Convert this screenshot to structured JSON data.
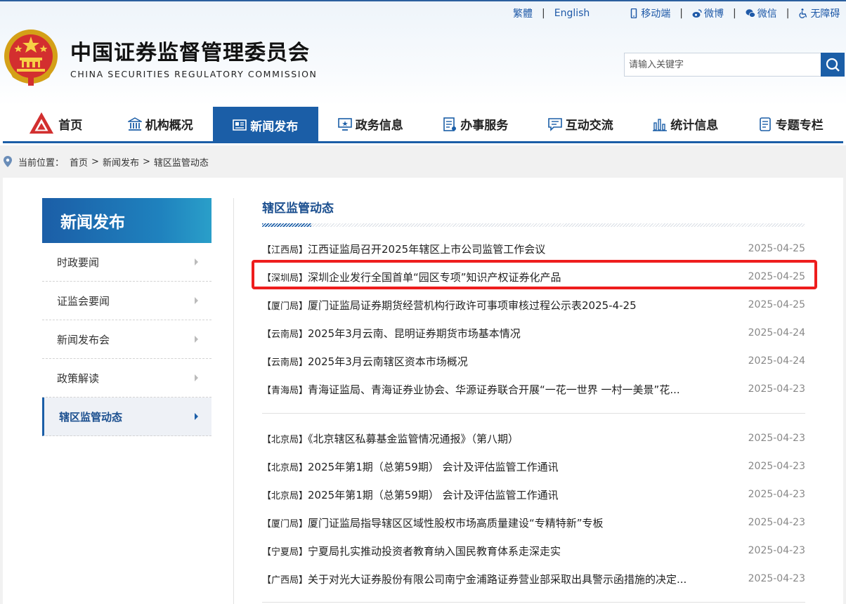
{
  "header": {
    "site_name_cn": "中国证券监督管理委员会",
    "site_name_en": "CHINA SECURITIES REGULATORY COMMISSION",
    "top_links": {
      "traditional": "繁體",
      "english": "English",
      "mobile": "移动端",
      "weibo": "微博",
      "wechat": "微信",
      "accessible": "无障碍"
    },
    "search_placeholder": "请输入关键字"
  },
  "nav": {
    "items": [
      {
        "label": "首页",
        "icon": "home-logo-icon"
      },
      {
        "label": "机构概况",
        "icon": "institution-icon"
      },
      {
        "label": "新闻发布",
        "icon": "newspaper-icon"
      },
      {
        "label": "政务信息",
        "icon": "monitor-icon"
      },
      {
        "label": "办事服务",
        "icon": "document-list-icon"
      },
      {
        "label": "互动交流",
        "icon": "chat-icon"
      },
      {
        "label": "统计信息",
        "icon": "bar-chart-icon"
      },
      {
        "label": "专题专栏",
        "icon": "note-icon"
      }
    ],
    "active_index": 2
  },
  "breadcrumb": {
    "prefix": "当前位置：",
    "items": [
      "首页",
      "新闻发布",
      "辖区监管动态"
    ],
    "separator": ">"
  },
  "sidebar": {
    "title": "新闻发布",
    "items": [
      "时政要闻",
      "证监会要闻",
      "新闻发布会",
      "政策解读",
      "辖区监管动态"
    ],
    "active_index": 4
  },
  "content": {
    "title": "辖区监管动态",
    "groups": [
      [
        {
          "tag": "【江西局】",
          "title": "江西证监局召开2025年辖区上市公司监管工作会议",
          "date": "2025-04-25"
        },
        {
          "tag": "【深圳局】",
          "title": "深圳企业发行全国首单“园区专项”知识产权证券化产品",
          "date": "2025-04-25"
        },
        {
          "tag": "【厦门局】",
          "title": "厦门证监局证券期货经营机构行政许可事项审核过程公示表2025-4-25",
          "date": "2025-04-25"
        },
        {
          "tag": "【云南局】",
          "title": "2025年3月云南、昆明证券期货市场基本情况",
          "date": "2025-04-24"
        },
        {
          "tag": "【云南局】",
          "title": "2025年3月云南辖区资本市场概况",
          "date": "2025-04-24"
        },
        {
          "tag": "【青海局】",
          "title": "青海证监局、青海证券业协会、华源证券联合开展“一花一世界 一村一美景”花...",
          "date": "2025-04-23"
        }
      ],
      [
        {
          "tag": "【北京局】",
          "title": "《北京辖区私募基金监管情况通报》（第八期）",
          "date": "2025-04-23"
        },
        {
          "tag": "【北京局】",
          "title": "2025年第1期（总第59期） 会计及评估监管工作通讯",
          "date": "2025-04-23"
        },
        {
          "tag": "【北京局】",
          "title": "2025年第1期（总第59期） 会计及评估监管工作通讯",
          "date": "2025-04-23"
        },
        {
          "tag": "【厦门局】",
          "title": "厦门证监局指导辖区区域性股权市场高质量建设“专精特新”专板",
          "date": "2025-04-23"
        },
        {
          "tag": "【宁夏局】",
          "title": "宁夏局扎实推动投资者教育纳入国民教育体系走深走实",
          "date": "2025-04-23"
        },
        {
          "tag": "【广西局】",
          "title": "关于对光大证券股份有限公司南宁金浦路证券营业部采取出具警示函措施的决定...",
          "date": "2025-04-23"
        }
      ]
    ]
  },
  "colors": {
    "primary": "#1b5ea7",
    "highlight": "#ee1d1d"
  }
}
